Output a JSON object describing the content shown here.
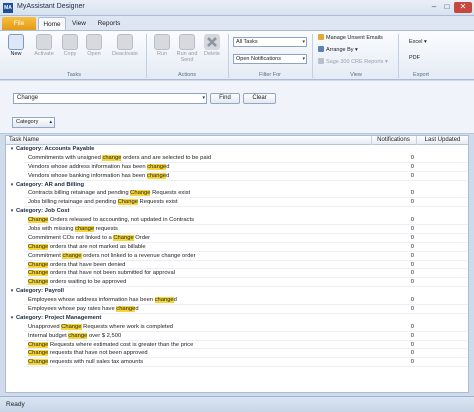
{
  "window": {
    "title": "MyAssistant Designer",
    "app_icon": "MA"
  },
  "tabs": {
    "file": "File",
    "home": "Home",
    "view": "View",
    "reports": "Reports"
  },
  "ribbon": {
    "tasks": {
      "new": "New",
      "activate": "Activate",
      "copy": "Copy",
      "open": "Open",
      "deactivate": "Deactivate",
      "label": "Tasks"
    },
    "actions": {
      "run": "Run",
      "run_and_send": "Run and Send",
      "delete": "Delete",
      "label": "Actions"
    },
    "filter": {
      "task_select": "All Tasks",
      "notif_select": "Open Notifications",
      "label": "Filter For"
    },
    "view": {
      "manage_unsent": "Manage Unsent Emails",
      "arrange_by": "Arrange By",
      "sage_reports": "Sage 300 CRE Reports",
      "label": "View"
    },
    "export": {
      "excel": "Excel",
      "pdf": "PDF",
      "label": "Export"
    }
  },
  "search": {
    "value": "Change",
    "find": "Find",
    "clear": "Clear",
    "category": "Category"
  },
  "grid": {
    "columns": {
      "name": "Task Name",
      "notifications": "Notifications",
      "last_updated": "Last Updated"
    },
    "groups": [
      {
        "title": "Category: Accounts Payable",
        "items": [
          {
            "pre": "Commitments with unsigned ",
            "hl": "change",
            "post": " orders and are selected to be paid",
            "count": "0"
          },
          {
            "pre": "Vendors whose address information has been ",
            "hl": "change",
            "post": "d",
            "count": "0"
          },
          {
            "pre": "Vendors whose banking information has been ",
            "hl": "change",
            "post": "d",
            "count": "0"
          }
        ]
      },
      {
        "title": "Category: AR and Billing",
        "items": [
          {
            "pre": "Contracts billing retainage and pending ",
            "hl": "Change",
            "post": " Requests exist",
            "count": "0"
          },
          {
            "pre": "Jobs billing retainage and pending ",
            "hl": "Change",
            "post": " Requests exist",
            "count": "0"
          }
        ]
      },
      {
        "title": "Category: Job Cost",
        "items": [
          {
            "pre": "",
            "hl": "Change",
            "post": " Orders released to accounting, not updated in Contracts",
            "count": "0"
          },
          {
            "pre": "Jobs with missing ",
            "hl": "change",
            "post": " requests",
            "count": "0"
          },
          {
            "pre": "Commitment COs not linked to a ",
            "hl": "Change",
            "post": " Order",
            "count": "0"
          },
          {
            "pre": "",
            "hl": "Change",
            "post": " orders that are not marked as billable",
            "count": "0"
          },
          {
            "pre": "Commitment ",
            "hl": "change",
            "post": " orders not linked to a revenue change order",
            "count": "0"
          },
          {
            "pre": "",
            "hl": "Change",
            "post": " orders that have been denied",
            "count": "0"
          },
          {
            "pre": "",
            "hl": "Change",
            "post": " orders that have not been submitted for approval",
            "count": "0"
          },
          {
            "pre": "",
            "hl": "Change",
            "post": " orders waiting to be approved",
            "count": "0"
          }
        ]
      },
      {
        "title": "Category: Payroll",
        "items": [
          {
            "pre": "Employees whose address information has been ",
            "hl": "change",
            "post": "d",
            "count": "0"
          },
          {
            "pre": "Employees whose pay rates have ",
            "hl": "change",
            "post": "d",
            "count": "0"
          }
        ]
      },
      {
        "title": "Category: Project Management",
        "items": [
          {
            "pre": "Unapproved ",
            "hl": "Change",
            "post": " Requests where work is completed",
            "count": "0"
          },
          {
            "pre": "Internal budget ",
            "hl": "change",
            "post": " over $ 2,500",
            "count": "0"
          },
          {
            "pre": "",
            "hl": "Change",
            "post": " Requests where estimated cost is greater than the price",
            "count": "0"
          },
          {
            "pre": "",
            "hl": "Change",
            "post": " requests that have not been approved",
            "count": "0"
          },
          {
            "pre": "",
            "hl": "Change",
            "post": " requests with null sales tax amounts",
            "count": "0"
          }
        ]
      }
    ]
  },
  "status": {
    "text": "Ready"
  },
  "colors": {
    "highlight": "#f6d53a",
    "file_tab": "#e8a11f",
    "close": "#c7463d"
  }
}
